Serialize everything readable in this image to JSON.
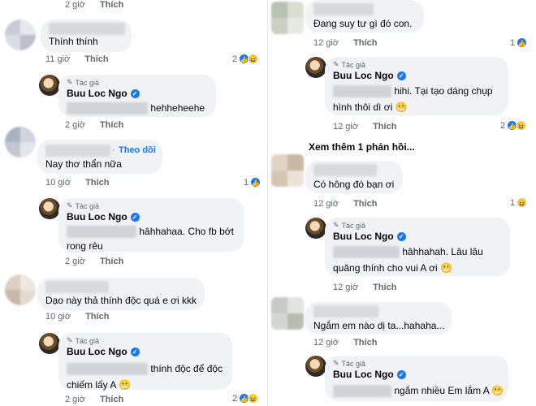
{
  "ui": {
    "like_label": "Thích",
    "author_tag": "Tác giả",
    "author_name": "Buu Loc Ngo",
    "follow_label": "Theo dõi"
  },
  "left": {
    "c0": {
      "time": "2 giờ"
    },
    "c1": {
      "text": "Thính thính",
      "time": "11 giờ",
      "reactions": "2"
    },
    "r1": {
      "text": "hehheheehe",
      "time": "2 giờ"
    },
    "c2": {
      "text": "Nay thơ thẩn nữa",
      "time": "10 giờ",
      "reactions": "1"
    },
    "r2": {
      "text": "hâhhahaa. Cho fb bớt rong rêu",
      "time": "2 giờ"
    },
    "c3": {
      "text": "Dạo này thả thính độc quá e ơi kkk",
      "time": "10 giờ"
    },
    "r3": {
      "text": "thính độc để độc chiếm lấy A",
      "emoji": "😬",
      "time": "2 giờ",
      "reactions": "2"
    }
  },
  "right": {
    "c1": {
      "text": "Đang suy tư gì đó con.",
      "time": "12 giờ",
      "reactions": "1"
    },
    "r1": {
      "text": "hihi. Tại tạo dáng chụp hình thôi dì ơi",
      "emoji": "😬",
      "time": "12 giờ",
      "reactions": "2"
    },
    "see_more": "Xem thêm 1 phản hồi...",
    "c2": {
      "text": "Có hông đó bạn ơi",
      "time": "12 giờ",
      "reactions": "1"
    },
    "r2": {
      "text": "hâhhahah. Lâu lâu quăng thính cho vui A ơi",
      "emoji": "😬",
      "time": "12 giờ"
    },
    "c3": {
      "text": "Ngắm em nào dị ta...hahaha...",
      "time": "12 giờ"
    },
    "r3": {
      "text": "ngắm nhiều Em lắm A",
      "emoji": "😬"
    }
  }
}
